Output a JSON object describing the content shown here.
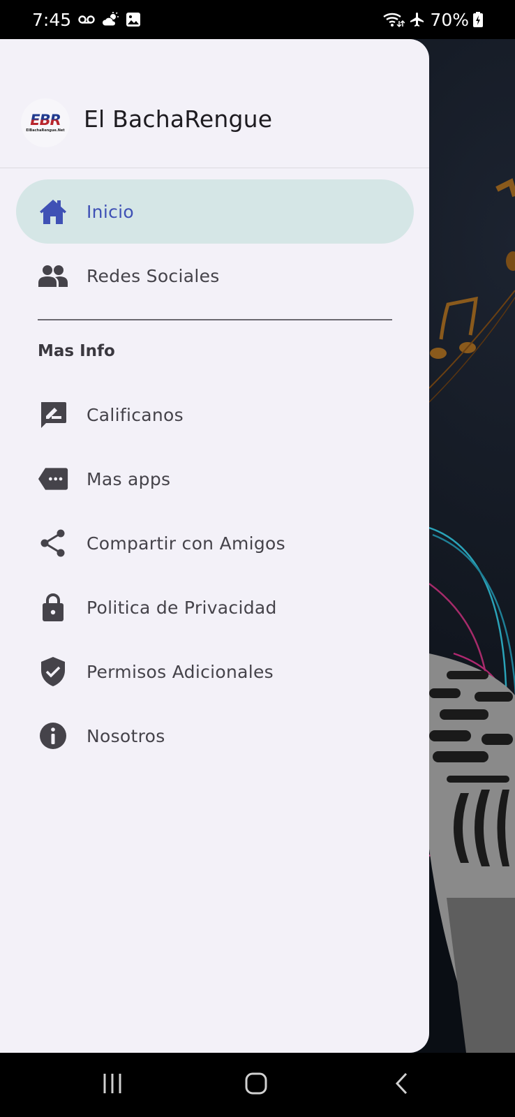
{
  "status_bar": {
    "time": "7:45",
    "left_icons": [
      "voicemail-icon",
      "weather-icon",
      "gallery-icon"
    ],
    "right_icons": [
      "wifi-icon",
      "airplane-mode-icon",
      "battery-charging-icon"
    ],
    "battery": "70%"
  },
  "drawer": {
    "app_title": "El BachaRengue",
    "logo_text": "EBR",
    "logo_subtext": "ElBachaRengue.Net",
    "primary_items": [
      {
        "label": "Inicio",
        "icon": "home-icon",
        "active": true
      },
      {
        "label": "Redes Sociales",
        "icon": "people-icon",
        "active": false
      }
    ],
    "section_title": "Mas Info",
    "secondary_items": [
      {
        "label": "Calificanos",
        "icon": "rate-review-icon"
      },
      {
        "label": "Mas apps",
        "icon": "more-apps-icon"
      },
      {
        "label": "Compartir con Amigos",
        "icon": "share-icon"
      },
      {
        "label": "Politica de Privacidad",
        "icon": "lock-icon"
      },
      {
        "label": "Permisos Adicionales",
        "icon": "shield-check-icon"
      },
      {
        "label": "Nosotros",
        "icon": "info-icon"
      }
    ]
  },
  "colors": {
    "accent": "#3f51b5",
    "active_item_bg": "#d5e6e6",
    "drawer_bg": "#f3f1f8",
    "icon_color": "#45434a"
  },
  "system_nav": {
    "buttons": [
      "recent-apps",
      "home",
      "back"
    ]
  }
}
